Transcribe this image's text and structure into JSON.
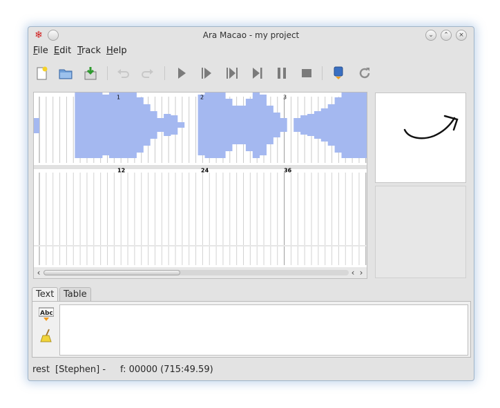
{
  "window": {
    "title": "Ara Macao - my project"
  },
  "menu": [
    {
      "accel": "F",
      "rest": "ile"
    },
    {
      "accel": "E",
      "rest": "dit"
    },
    {
      "accel": "T",
      "rest": "rack"
    },
    {
      "accel": "H",
      "rest": "elp"
    }
  ],
  "toolbar_icons": [
    "new-file-icon",
    "open-folder-icon",
    "save-icon",
    "undo-icon",
    "redo-icon",
    "play-icon",
    "play-from-icon",
    "play-next-icon",
    "skip-end-icon",
    "pause-icon",
    "stop-icon",
    "record-icon",
    "refresh-icon"
  ],
  "score": {
    "upper_markers": [
      "1",
      "2",
      "3"
    ],
    "lower_markers": [
      "12",
      "24",
      "36"
    ]
  },
  "tabs": [
    "Text",
    "Table"
  ],
  "status": {
    "mode": "rest",
    "user": "[Stephen] -",
    "frame": "f: 00000 (715:49.59)"
  },
  "colors": {
    "accent_waveform": "#a4b8f0",
    "window_glow": "#5a8cc8"
  }
}
